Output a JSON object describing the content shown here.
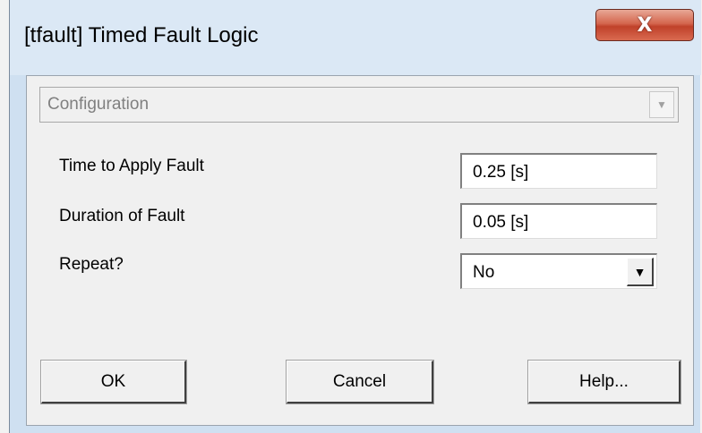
{
  "window": {
    "title": "[tfault] Timed Fault Logic",
    "close_label": "X"
  },
  "category": {
    "selected": "Configuration"
  },
  "params": [
    {
      "label": "Time to Apply Fault",
      "value": "0.25 [s]"
    },
    {
      "label": "Duration of Fault",
      "value": "0.05 [s]"
    },
    {
      "label": "Repeat?",
      "value": "No"
    }
  ],
  "buttons": {
    "ok": "OK",
    "cancel": "Cancel",
    "help": "Help..."
  },
  "icons": {
    "close": "close-icon",
    "dropdown": "chevron-down-icon"
  }
}
